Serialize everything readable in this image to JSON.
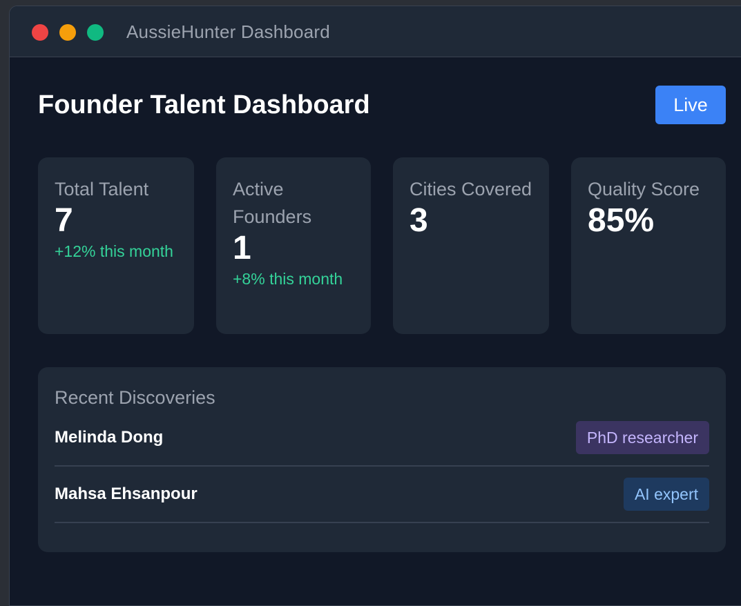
{
  "window": {
    "title": "AussieHunter Dashboard",
    "controls": [
      "close",
      "minimize",
      "maximize"
    ]
  },
  "header": {
    "title": "Founder Talent Dashboard",
    "live_label": "Live"
  },
  "stats": [
    {
      "label": "Total Talent",
      "value": "7",
      "delta": "+12% this month"
    },
    {
      "label": "Active Founders",
      "value": "1",
      "delta": "+8% this month"
    },
    {
      "label": "Cities Covered",
      "value": "3",
      "delta": ""
    },
    {
      "label": "Quality Score",
      "value": "85%",
      "delta": ""
    }
  ],
  "recent": {
    "title": "Recent Discoveries",
    "items": [
      {
        "name": "Melinda Dong",
        "tag": "PhD researcher",
        "tag_color": "#c4b5fd"
      },
      {
        "name": "Mahsa Ehsanpour",
        "tag": "AI expert",
        "tag_color": "#93c5fd"
      }
    ]
  },
  "colors": {
    "background": "#111827",
    "card": "#1f2937",
    "accent": "#3b82f6",
    "positive": "#34d399"
  }
}
